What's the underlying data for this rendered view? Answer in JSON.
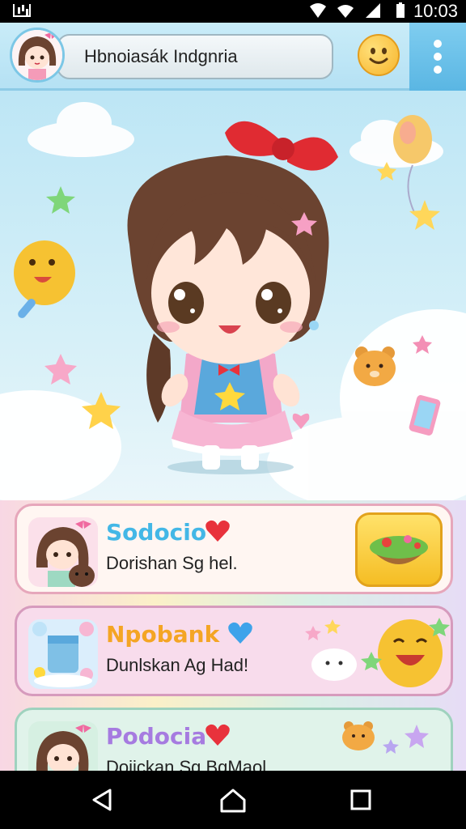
{
  "status_bar": {
    "time": "10:03",
    "icons": [
      "gallery-icon",
      "signal-icon",
      "wifi-icon",
      "cell-icon",
      "battery-icon"
    ]
  },
  "header": {
    "search_text": "Hbnoiasák Indgnria",
    "avatar": "girl-avatar",
    "emoji_button": "smiley-icon",
    "menu_button": "more-vert-icon"
  },
  "cards": [
    {
      "title": "Sodocio",
      "subtitle": "Dorishan Sg hel.",
      "heart": "red-heart-icon",
      "title_color": "#43b7e6",
      "heart_color": "#e8323c",
      "thumb": "girl-with-bear",
      "action": "salad-bowl-button"
    },
    {
      "title": "Npobank",
      "subtitle": "Dunlskan Ag Had!",
      "heart": "blue-heart-icon",
      "title_color": "#f4a524",
      "heart_color": "#3ea3ea",
      "thumb": "jar-with-bubbles",
      "action": "laughing-face-sticker"
    },
    {
      "title": "Podocia",
      "subtitle": "Doiickan Sg BgMaol",
      "heart": "red-heart-icon",
      "title_color": "#a67be0",
      "heart_color": "#e8323c",
      "thumb": "girl-avatar",
      "action": "bear-sticker"
    }
  ],
  "nav": [
    "back-icon",
    "home-icon",
    "recents-icon"
  ]
}
